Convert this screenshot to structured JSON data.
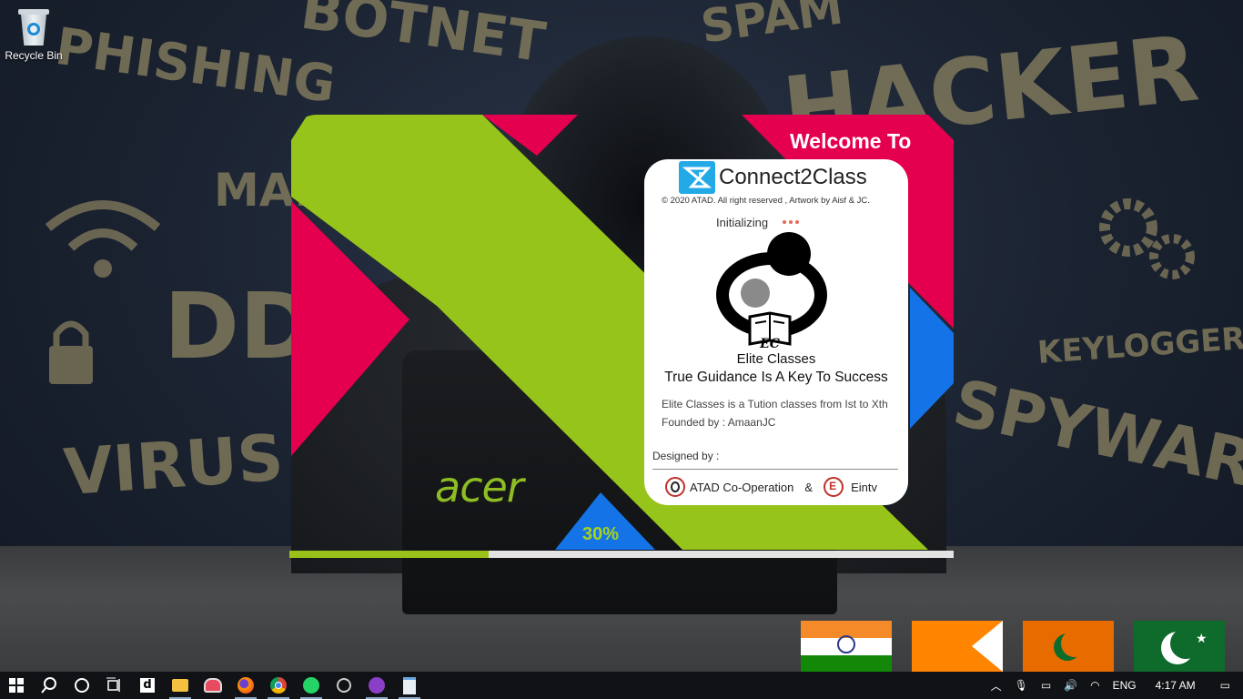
{
  "desktop": {
    "icons": [
      {
        "label": "Recycle Bin",
        "icon": "recycle-bin-icon"
      }
    ],
    "wallpaper_words": [
      "PHISHING",
      "BOTNET",
      "SPAM",
      "HACKER",
      "MAL",
      "DDO",
      "VIRUS",
      "KEYLOGGER",
      "SPYWARE"
    ],
    "laptop_brand": "acer"
  },
  "splash": {
    "welcome": "Welcome To",
    "app_name": "Connect2Class",
    "copyright": "© 2020 ATAD. All right reserved , Artwork by Aisf & JC.",
    "status": "Initializing",
    "org_logo_text": "EC",
    "org_name": "Elite Classes",
    "tagline": "True Guidance Is A Key To Success",
    "description_line1": "Elite Classes is a Tution classes from Ist to Xth",
    "description_line2": "Founded by : AmaanJC",
    "designed_by_label": "Designed by :",
    "credit1": "ATAD Co-Operation",
    "credit_sep": "&",
    "credit2": "Eintv",
    "progress_label": "30%",
    "progress": 0.3,
    "colors": {
      "green": "#96c41a",
      "pink": "#e5004f",
      "blue": "#1473e6"
    }
  },
  "flags": [
    "india",
    "orange-arrow",
    "crescent",
    "pakistan"
  ],
  "taskbar": {
    "apps": [
      "start",
      "search",
      "task-view",
      "timeline",
      "dailymotion",
      "file-explorer",
      "paint",
      "firefox",
      "chrome",
      "whatsapp",
      "obs",
      "app-purple",
      "notepad"
    ],
    "tray": {
      "language": "ENG",
      "time": "4:17 AM"
    }
  }
}
